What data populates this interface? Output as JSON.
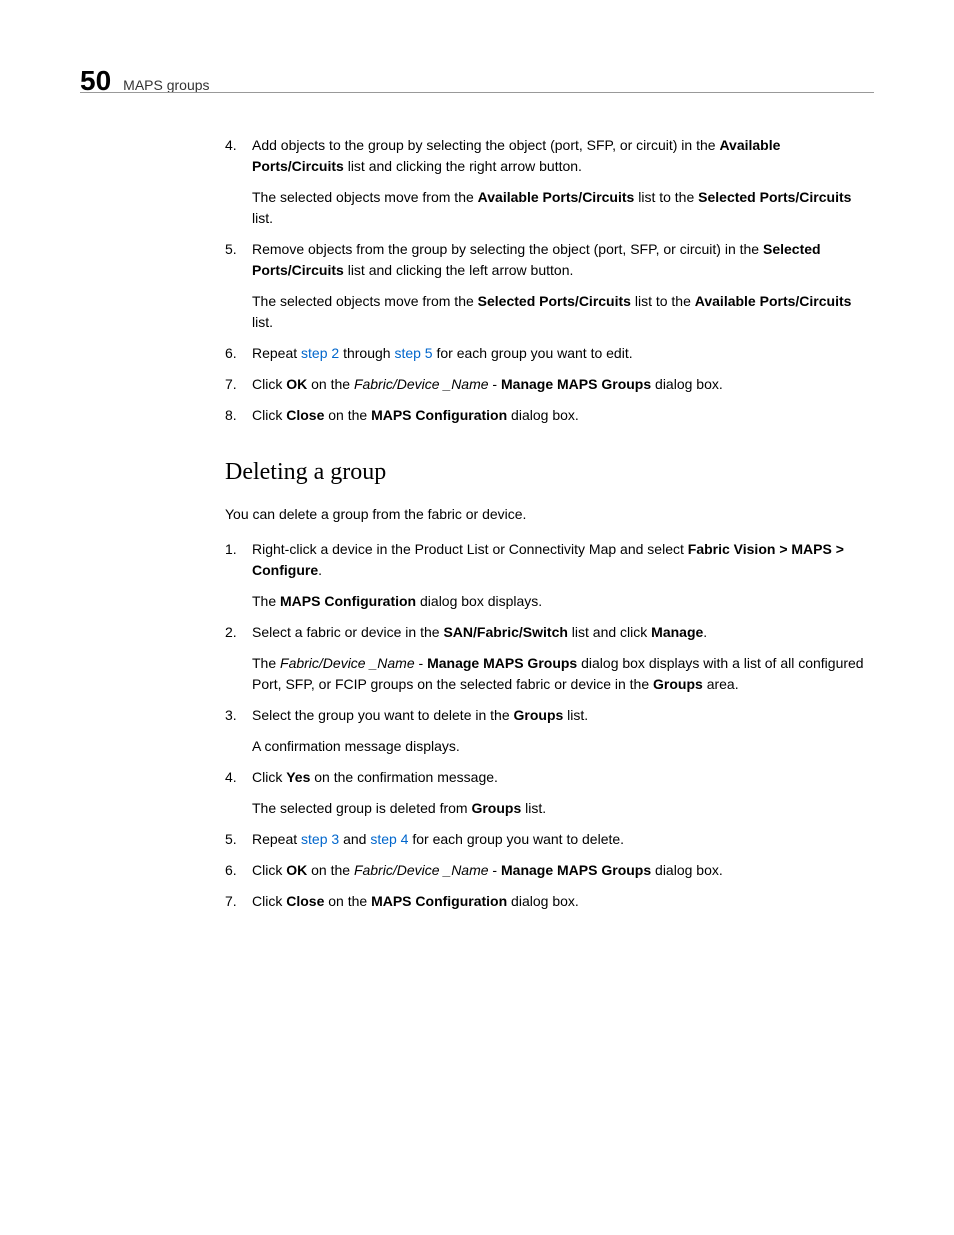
{
  "header": {
    "page_number": "50",
    "title": "MAPS groups"
  },
  "section1": {
    "items": [
      {
        "num": "4.",
        "paragraphs": [
          {
            "segments": [
              {
                "t": "Add objects to the group by selecting the object (port, SFP, or circuit) in the "
              },
              {
                "t": "Available Ports/Circuits",
                "bold": true
              },
              {
                "t": " list and clicking the right arrow button."
              }
            ]
          },
          {
            "segments": [
              {
                "t": "The selected objects move from the "
              },
              {
                "t": "Available Ports/Circuits",
                "bold": true
              },
              {
                "t": " list to the "
              },
              {
                "t": "Selected Ports/Circuits",
                "bold": true
              },
              {
                "t": " list."
              }
            ]
          }
        ]
      },
      {
        "num": "5.",
        "paragraphs": [
          {
            "segments": [
              {
                "t": "Remove objects from the group by selecting the object (port, SFP, or circuit) in the "
              },
              {
                "t": "Selected Ports/Circuits",
                "bold": true
              },
              {
                "t": " list and clicking the left arrow button."
              }
            ]
          },
          {
            "segments": [
              {
                "t": "The selected objects move from the "
              },
              {
                "t": "Selected Ports/Circuits",
                "bold": true
              },
              {
                "t": " list to the "
              },
              {
                "t": "Available Ports/Circuits",
                "bold": true
              },
              {
                "t": " list."
              }
            ]
          }
        ]
      },
      {
        "num": "6.",
        "paragraphs": [
          {
            "segments": [
              {
                "t": "Repeat "
              },
              {
                "t": "step 2",
                "link": true
              },
              {
                "t": " through "
              },
              {
                "t": "step 5",
                "link": true
              },
              {
                "t": " for each group you want to edit."
              }
            ]
          }
        ]
      },
      {
        "num": "7.",
        "paragraphs": [
          {
            "segments": [
              {
                "t": "Click "
              },
              {
                "t": "OK",
                "bold": true
              },
              {
                "t": " on the "
              },
              {
                "t": "Fabric/Device _Name",
                "italic": true
              },
              {
                "t": " - "
              },
              {
                "t": "Manage MAPS Groups",
                "bold": true
              },
              {
                "t": " dialog box."
              }
            ]
          }
        ]
      },
      {
        "num": "8.",
        "paragraphs": [
          {
            "segments": [
              {
                "t": "Click "
              },
              {
                "t": "Close",
                "bold": true
              },
              {
                "t": " on the "
              },
              {
                "t": "MAPS Configuration",
                "bold": true
              },
              {
                "t": " dialog box."
              }
            ]
          }
        ]
      }
    ]
  },
  "section2": {
    "heading": "Deleting a group",
    "intro": "You can delete a group from the fabric or device.",
    "items": [
      {
        "num": "1.",
        "paragraphs": [
          {
            "segments": [
              {
                "t": "Right-click a device in the Product List or Connectivity Map and select "
              },
              {
                "t": "Fabric Vision > MAPS > Configure",
                "bold": true
              },
              {
                "t": "."
              }
            ]
          },
          {
            "segments": [
              {
                "t": "The "
              },
              {
                "t": "MAPS Configuration",
                "bold": true
              },
              {
                "t": " dialog box displays."
              }
            ]
          }
        ]
      },
      {
        "num": "2.",
        "paragraphs": [
          {
            "segments": [
              {
                "t": "Select a fabric or device in the "
              },
              {
                "t": "SAN/Fabric/Switch",
                "bold": true
              },
              {
                "t": " list and click "
              },
              {
                "t": "Manage",
                "bold": true
              },
              {
                "t": "."
              }
            ]
          },
          {
            "segments": [
              {
                "t": "The "
              },
              {
                "t": "Fabric/Device _Name",
                "italic": true
              },
              {
                "t": " - "
              },
              {
                "t": "Manage MAPS Groups",
                "bold": true
              },
              {
                "t": " dialog box displays with a list of all configured Port, SFP, or FCIP groups on the selected fabric or device in the "
              },
              {
                "t": "Groups",
                "bold": true
              },
              {
                "t": " area."
              }
            ]
          }
        ]
      },
      {
        "num": "3.",
        "paragraphs": [
          {
            "segments": [
              {
                "t": "Select the group you want to delete in the "
              },
              {
                "t": "Groups",
                "bold": true
              },
              {
                "t": " list."
              }
            ]
          },
          {
            "segments": [
              {
                "t": "A confirmation message displays."
              }
            ]
          }
        ]
      },
      {
        "num": "4.",
        "paragraphs": [
          {
            "segments": [
              {
                "t": "Click "
              },
              {
                "t": "Yes",
                "bold": true
              },
              {
                "t": " on the confirmation message."
              }
            ]
          },
          {
            "segments": [
              {
                "t": "The selected group is deleted from "
              },
              {
                "t": "Groups",
                "bold": true
              },
              {
                "t": " list."
              }
            ]
          }
        ]
      },
      {
        "num": "5.",
        "paragraphs": [
          {
            "segments": [
              {
                "t": "Repeat "
              },
              {
                "t": "step 3",
                "link": true
              },
              {
                "t": " and "
              },
              {
                "t": "step 4",
                "link": true
              },
              {
                "t": " for each group you want to delete."
              }
            ]
          }
        ]
      },
      {
        "num": "6.",
        "paragraphs": [
          {
            "segments": [
              {
                "t": "Click "
              },
              {
                "t": "OK",
                "bold": true
              },
              {
                "t": " on the "
              },
              {
                "t": "Fabric/Device _Name",
                "italic": true
              },
              {
                "t": " - "
              },
              {
                "t": "Manage MAPS Groups",
                "bold": true
              },
              {
                "t": " dialog box."
              }
            ]
          }
        ]
      },
      {
        "num": "7.",
        "paragraphs": [
          {
            "segments": [
              {
                "t": "Click "
              },
              {
                "t": "Close",
                "bold": true
              },
              {
                "t": " on the "
              },
              {
                "t": "MAPS Configuration",
                "bold": true
              },
              {
                "t": " dialog box."
              }
            ]
          }
        ]
      }
    ]
  }
}
